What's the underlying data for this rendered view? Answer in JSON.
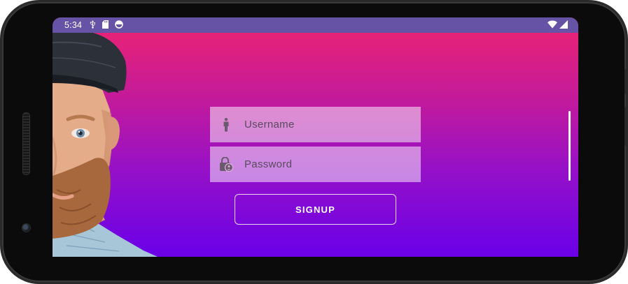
{
  "status_bar": {
    "time": "5:34",
    "left_icons": [
      "usb-icon",
      "sd-card-icon",
      "sync-icon"
    ],
    "right_icons": [
      "wifi-icon",
      "cellular-signal-icon"
    ],
    "background_color": "#6753a6"
  },
  "background_gradient": [
    "#ee2470",
    "#c21a9c",
    "#9410c9",
    "#6a00e8"
  ],
  "login_form": {
    "username": {
      "placeholder": "Username",
      "icon": "person-icon"
    },
    "password": {
      "placeholder": "Password",
      "icon": "lock-account-icon"
    },
    "signup_label": "SIGNUP"
  }
}
